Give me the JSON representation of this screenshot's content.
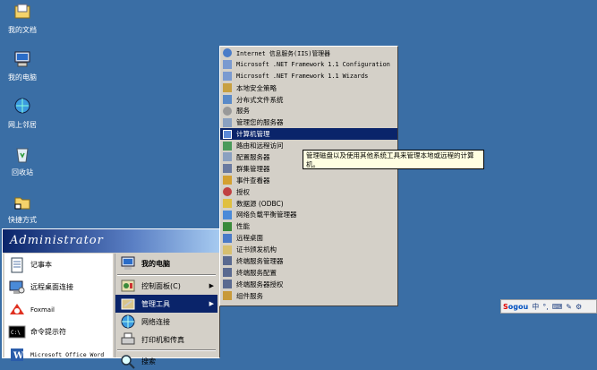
{
  "desktop": {
    "icons": [
      {
        "label": "我的文档",
        "icon": "my-documents-icon"
      },
      {
        "label": "我的电脑",
        "icon": "my-computer-icon"
      },
      {
        "label": "网上邻居",
        "icon": "network-places-icon"
      },
      {
        "label": "回收站",
        "icon": "recycle-bin-icon"
      },
      {
        "label": "快捷方式",
        "icon": "shortcut-folder-icon"
      }
    ]
  },
  "start_menu": {
    "user": "Administrator",
    "left_items": [
      {
        "label": "记事本",
        "icon": "notepad-icon"
      },
      {
        "label": "远程桌面连接",
        "icon": "remote-desktop-icon"
      },
      {
        "label": "Foxmail",
        "icon": "foxmail-icon"
      },
      {
        "label": "命令提示符",
        "icon": "command-prompt-icon"
      },
      {
        "label": "Microsoft Office Word",
        "icon": "word-icon"
      }
    ],
    "right_items": [
      {
        "label": "我的电脑",
        "icon": "my-computer-icon",
        "bold": true
      },
      {
        "label": "控制面板(C)",
        "icon": "control-panel-icon",
        "arrow": "▶"
      },
      {
        "label": "管理工具",
        "icon": "admin-tools-icon",
        "arrow": "▶",
        "selected": true
      },
      {
        "label": "网络连接",
        "icon": "network-connections-icon"
      },
      {
        "label": "打印机和传真",
        "icon": "printers-icon"
      },
      {
        "label": "搜索",
        "icon": "search-icon"
      }
    ]
  },
  "admin_tools_menu": [
    {
      "label": "Internet 信息服务(IIS)管理器",
      "latin": true
    },
    {
      "label": "Microsoft .NET Framework 1.1 Configuration",
      "latin": true
    },
    {
      "label": "Microsoft .NET Framework 1.1 Wizards",
      "latin": true
    },
    {
      "label": "本地安全策略"
    },
    {
      "label": "分布式文件系统"
    },
    {
      "label": "服务"
    },
    {
      "label": "管理您的服务器"
    },
    {
      "label": "计算机管理",
      "selected": true
    },
    {
      "label": "路由和远程访问"
    },
    {
      "label": "配置服务器"
    },
    {
      "label": "群集管理器"
    },
    {
      "label": "事件查看器"
    },
    {
      "label": "授权"
    },
    {
      "label": "数据源 (ODBC)"
    },
    {
      "label": "网络负载平衡管理器"
    },
    {
      "label": "性能"
    },
    {
      "label": "远程桌面"
    },
    {
      "label": "证书颁发机构"
    },
    {
      "label": "终端服务管理器"
    },
    {
      "label": "终端服务配置"
    },
    {
      "label": "终端服务器授权"
    },
    {
      "label": "组件服务"
    }
  ],
  "tooltip": {
    "text": "管理磁盘以及使用其他系统工具来管理本地或远程的计算机。"
  },
  "ime_bar": {
    "brand_s": "S",
    "brand_rest": "ogou",
    "mode": "中",
    "symbols": [
      "°,",
      "⌨",
      "✎",
      "⚙"
    ]
  }
}
